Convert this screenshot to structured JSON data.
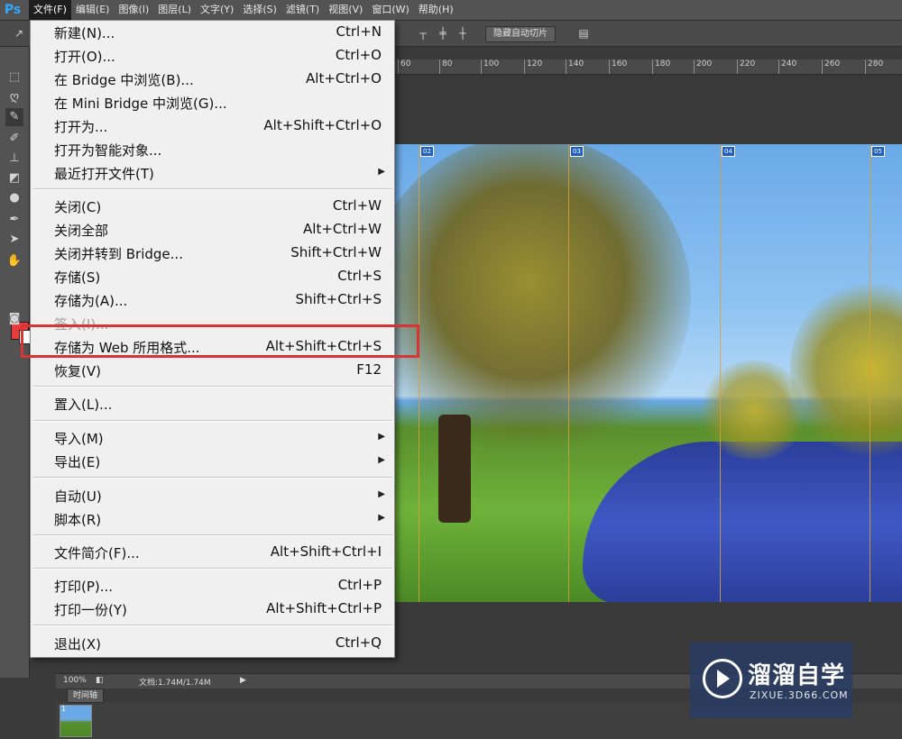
{
  "app": {
    "logo": "Ps"
  },
  "menubar": {
    "items": [
      "文件(F)",
      "编辑(E)",
      "图像(I)",
      "图层(L)",
      "文字(Y)",
      "选择(S)",
      "滤镜(T)",
      "视图(V)",
      "窗口(W)",
      "帮助(H)"
    ],
    "active_index": 0
  },
  "optionsbar": {
    "hide_auto_slices_label": "隐藏自动切片"
  },
  "ruler": {
    "ticks": [
      "60",
      "80",
      "100",
      "120",
      "140",
      "160",
      "180",
      "200",
      "220",
      "240",
      "260",
      "280"
    ]
  },
  "canvas": {
    "slice_tags": [
      "02",
      "03",
      "04",
      "05"
    ]
  },
  "file_menu": {
    "items": [
      {
        "label": "新建(N)...",
        "shortcut": "Ctrl+N"
      },
      {
        "label": "打开(O)...",
        "shortcut": "Ctrl+O"
      },
      {
        "label": "在 Bridge 中浏览(B)...",
        "shortcut": "Alt+Ctrl+O"
      },
      {
        "label": "在 Mini Bridge 中浏览(G)...",
        "shortcut": ""
      },
      {
        "label": "打开为...",
        "shortcut": "Alt+Shift+Ctrl+O"
      },
      {
        "label": "打开为智能对象...",
        "shortcut": ""
      },
      {
        "label": "最近打开文件(T)",
        "shortcut": "",
        "submenu": true
      },
      {
        "label": "关闭(C)",
        "shortcut": "Ctrl+W"
      },
      {
        "label": "关闭全部",
        "shortcut": "Alt+Ctrl+W"
      },
      {
        "label": "关闭并转到 Bridge...",
        "shortcut": "Shift+Ctrl+W"
      },
      {
        "label": "存储(S)",
        "shortcut": "Ctrl+S"
      },
      {
        "label": "存储为(A)...",
        "shortcut": "Shift+Ctrl+S"
      },
      {
        "label": "签入(I)...",
        "shortcut": "",
        "disabled": true
      },
      {
        "label": "存储为 Web 所用格式...",
        "shortcut": "Alt+Shift+Ctrl+S",
        "highlighted": true
      },
      {
        "label": "恢复(V)",
        "shortcut": "F12"
      },
      {
        "label": "置入(L)...",
        "shortcut": ""
      },
      {
        "label": "导入(M)",
        "shortcut": "",
        "submenu": true
      },
      {
        "label": "导出(E)",
        "shortcut": "",
        "submenu": true
      },
      {
        "label": "自动(U)",
        "shortcut": "",
        "submenu": true
      },
      {
        "label": "脚本(R)",
        "shortcut": "",
        "submenu": true
      },
      {
        "label": "文件简介(F)...",
        "shortcut": "Alt+Shift+Ctrl+I"
      },
      {
        "label": "打印(P)...",
        "shortcut": "Ctrl+P"
      },
      {
        "label": "打印一份(Y)",
        "shortcut": "Alt+Shift+Ctrl+P"
      },
      {
        "label": "退出(X)",
        "shortcut": "Ctrl+Q"
      }
    ],
    "submenu_arrow": "▶"
  },
  "statusbar": {
    "zoom": "100%",
    "doc_info": "文档:1.74M/1.74M",
    "nav_arrow": "▶"
  },
  "timeline": {
    "tab_label": "时间轴",
    "frame_number": "1"
  },
  "watermark": {
    "title": "溜溜自学",
    "subtitle": "ZIXUE.3D66.COM"
  },
  "colors": {
    "foreground": "#e83b3b",
    "background": "#ffffff",
    "highlight": "#d93434"
  },
  "icons": [
    "move-icon",
    "marquee-icon",
    "lasso-icon",
    "quick-select-icon",
    "crop-icon",
    "eyedropper-icon",
    "brush-icon",
    "stamp-icon",
    "eraser-icon",
    "blur-icon",
    "pen-icon",
    "path-select-icon",
    "hand-icon",
    "mask-icon"
  ]
}
